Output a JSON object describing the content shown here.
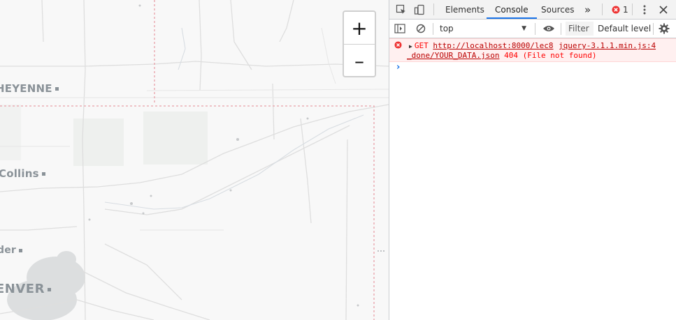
{
  "map": {
    "cities": {
      "cheyenne": "HEYENNE",
      "fort_collins": "Collins",
      "boulder": "der",
      "denver": "ENVER"
    },
    "zoom": {
      "in_label": "+",
      "out_label": "–"
    },
    "colors": {
      "background": "#f8f8f8",
      "roads": "#dcdcdc",
      "border": "#e8a0a8",
      "urban": "#c9cccf"
    }
  },
  "devtools": {
    "tabs": {
      "elements": "Elements",
      "console": "Console",
      "sources": "Sources",
      "more": "»"
    },
    "error_count": "1",
    "toolbar": {
      "context": "top",
      "filter_placeholder": "Filter",
      "levels": "Default levels"
    },
    "error": {
      "method": "GET",
      "url_part1": "http://localhost:8000/lec8",
      "url_part2": "_done/YOUR_DATA.json",
      "status": "404 (File not found)",
      "source": "jquery-3.1.1.min.js:4"
    },
    "prompt": "›",
    "colors": {
      "accent": "#1a73e8",
      "error": "#ff0000",
      "error_bg": "#fff0f0"
    }
  }
}
